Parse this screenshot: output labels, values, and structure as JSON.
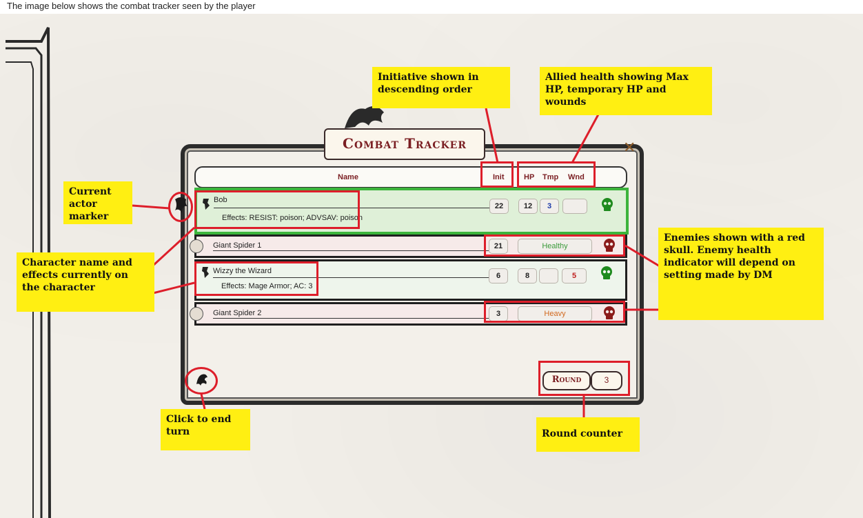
{
  "caption": "The image below shows the combat tracker seen by the player",
  "tracker": {
    "title": "Combat Tracker",
    "columns": {
      "name": "Name",
      "init": "Init",
      "hp": "HP",
      "tmp": "Tmp",
      "wnd": "Wnd"
    },
    "round_label": "Round",
    "round_value": "3"
  },
  "rows": [
    {
      "name": "Bob",
      "effects": "Effects: RESIST: poison; ADVSAV: poison",
      "init": "22",
      "hp": "12",
      "tmp": "3",
      "wnd": "",
      "faction": "friendly",
      "active": true,
      "skull_color": "#1e8a1e"
    },
    {
      "name": "Giant Spider 1",
      "effects": "",
      "init": "21",
      "health": "Healthy",
      "health_color": "#3a9a3a",
      "faction": "enemy",
      "skull_color": "#8b1a1a"
    },
    {
      "name": "Wizzy the Wizard",
      "effects": "Effects: Mage Armor; AC: 3",
      "init": "6",
      "hp": "8",
      "tmp": "",
      "wnd": "5",
      "faction": "friendly",
      "skull_color": "#1e8a1e"
    },
    {
      "name": "Giant Spider 2",
      "effects": "",
      "init": "3",
      "health": "Heavy",
      "health_color": "#d2691e",
      "faction": "enemy",
      "skull_color": "#8b1a1a"
    }
  ],
  "annotations": {
    "initiative": "Initiative shown in descending order",
    "allied_health": "Allied health showing Max HP, temporary HP and wounds",
    "current_actor": "Current actor marker",
    "character_name": "Character name and effects currently on the character",
    "enemies": "Enemies shown with a red skull. Enemy health indicator will depend on setting made by DM",
    "end_turn": "Click to end turn",
    "round_counter": "Round counter"
  },
  "colors": {
    "annotation_bg": "#ffef12",
    "highlight_red": "#dd1e2a",
    "active_green": "#3cb43c",
    "title_red": "#7a1e22"
  }
}
